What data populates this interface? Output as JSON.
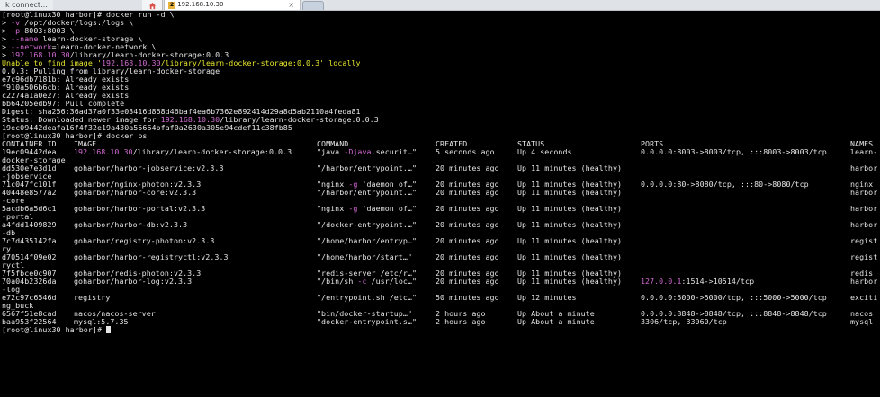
{
  "tabs": {
    "connect_label": "k connect...",
    "active_number": "2",
    "active_title": "192.168.10.30",
    "close_glyph": "×"
  },
  "icons": {
    "home": "home-icon",
    "new_tab": "new-tab-icon",
    "close": "close-icon"
  },
  "colors": {
    "background": "#000000",
    "text": "#e6e6e6",
    "ip": "#d46bd4",
    "warning": "#e6e62e"
  },
  "terminal": {
    "lines": [
      {
        "segs": [
          {
            "t": "[root@linux30 harbor]# docker run -d \\"
          }
        ]
      },
      {
        "segs": [
          {
            "t": "> "
          },
          {
            "t": "-v",
            "c": "mag"
          },
          {
            "t": " /opt/docker/logs:/logs \\"
          }
        ]
      },
      {
        "segs": [
          {
            "t": "> "
          },
          {
            "t": "-p",
            "c": "mag"
          },
          {
            "t": " 8003:8003 \\"
          }
        ]
      },
      {
        "segs": [
          {
            "t": "> "
          },
          {
            "t": "--name",
            "c": "mag"
          },
          {
            "t": " learn-docker-storage \\"
          }
        ]
      },
      {
        "segs": [
          {
            "t": "> "
          },
          {
            "t": "--network",
            "c": "mag"
          },
          {
            "t": "=learn-docker-network \\"
          }
        ]
      },
      {
        "segs": [
          {
            "t": "> "
          },
          {
            "t": "192.168.10.30",
            "c": "mag"
          },
          {
            "t": "/library/learn-docker-storage:0.0.3"
          }
        ]
      },
      {
        "segs": [
          {
            "t": "Unable to find image '",
            "c": "yel"
          },
          {
            "t": "192.168.10.30",
            "c": "mag"
          },
          {
            "t": "/library/learn-docker-storage:0.0.3' locally",
            "c": "yel"
          }
        ]
      },
      {
        "segs": [
          {
            "t": "0.0.3: Pulling from library/learn-docker-storage"
          }
        ]
      },
      {
        "segs": [
          {
            "t": "e7c96db7181b: Already exists"
          }
        ]
      },
      {
        "segs": [
          {
            "t": "f910a506b6cb: Already exists"
          }
        ]
      },
      {
        "segs": [
          {
            "t": "c2274a1a0e27: Already exists"
          }
        ]
      },
      {
        "segs": [
          {
            "t": "bb64205edb97: Pull complete"
          }
        ]
      },
      {
        "segs": [
          {
            "t": "Digest: sha256:36ad37a0f33e03416d868d46baf4ea6b7362e892414d29a8d5ab2110a4feda81"
          }
        ]
      },
      {
        "segs": [
          {
            "t": "Status: Downloaded newer image for "
          },
          {
            "t": "192.168.10.30",
            "c": "mag"
          },
          {
            "t": "/library/learn-docker-storage:0.0.3"
          }
        ]
      },
      {
        "segs": [
          {
            "t": "19ec09442deafa16f4f32e19a430a55664bfaf0a2630a305e94cdef11c38fb85"
          }
        ]
      },
      {
        "segs": [
          {
            "t": "[root@linux30 harbor]# docker ps"
          }
        ]
      }
    ],
    "ps_headers": [
      "CONTAINER ID",
      "IMAGE",
      "COMMAND",
      "CREATED",
      "STATUS",
      "PORTS",
      "NAMES"
    ],
    "ps_rows": [
      {
        "id": "19ec09442dea",
        "image": [
          {
            "t": "192.168.10.30",
            "c": "mag"
          },
          {
            "t": "/library/learn-docker-storage:0.0.3"
          }
        ],
        "command": [
          {
            "t": "\"java "
          },
          {
            "t": "-Djava",
            "c": "mag"
          },
          {
            "t": ".securit…\""
          }
        ],
        "created": "5 seconds ago",
        "status": "Up 4 seconds",
        "ports": [
          {
            "t": "0.0.0.0:8003->8003/tcp, :::8003->8003/tcp"
          }
        ],
        "names": "learn-"
      },
      {
        "cont": "docker-storage"
      },
      {
        "id": "dd530e7e3d1d",
        "image": [
          {
            "t": "goharbor/harbor-jobservice:v2.3.3"
          }
        ],
        "command": [
          {
            "t": "\"/harbor/entrypoint.…\""
          }
        ],
        "created": "20 minutes ago",
        "status": "Up 11 minutes (healthy)",
        "ports": [],
        "names": "harbor"
      },
      {
        "cont": "-jobservice"
      },
      {
        "id": "71c047fc101f",
        "image": [
          {
            "t": "goharbor/nginx-photon:v2.3.3"
          }
        ],
        "command": [
          {
            "t": "\"nginx "
          },
          {
            "t": "-g",
            "c": "mag"
          },
          {
            "t": " 'daemon of…\""
          }
        ],
        "created": "20 minutes ago",
        "status": "Up 11 minutes (healthy)",
        "ports": [
          {
            "t": "0.0.0.0:80->8080/tcp, :::80->8080/tcp"
          }
        ],
        "names": "nginx"
      },
      {
        "id": "40448e8577a2",
        "image": [
          {
            "t": "goharbor/harbor-core:v2.3.3"
          }
        ],
        "command": [
          {
            "t": "\"/harbor/entrypoint.…\""
          }
        ],
        "created": "20 minutes ago",
        "status": "Up 11 minutes (healthy)",
        "ports": [],
        "names": "harbor"
      },
      {
        "cont": "-core"
      },
      {
        "id": "5acdb6a5d6c1",
        "image": [
          {
            "t": "goharbor/harbor-portal:v2.3.3"
          }
        ],
        "command": [
          {
            "t": "\"nginx "
          },
          {
            "t": "-g",
            "c": "mag"
          },
          {
            "t": " 'daemon of…\""
          }
        ],
        "created": "20 minutes ago",
        "status": "Up 11 minutes (healthy)",
        "ports": [],
        "names": "harbor"
      },
      {
        "cont": "-portal"
      },
      {
        "id": "a4fdd1409829",
        "image": [
          {
            "t": "goharbor/harbor-db:v2.3.3"
          }
        ],
        "command": [
          {
            "t": "\"/docker-entrypoint.…\""
          }
        ],
        "created": "20 minutes ago",
        "status": "Up 11 minutes (healthy)",
        "ports": [],
        "names": "harbor"
      },
      {
        "cont": "-db"
      },
      {
        "id": "7c7d435142fa",
        "image": [
          {
            "t": "goharbor/registry-photon:v2.3.3"
          }
        ],
        "command": [
          {
            "t": "\"/home/harbor/entryp…\""
          }
        ],
        "created": "20 minutes ago",
        "status": "Up 11 minutes (healthy)",
        "ports": [],
        "names": "regist"
      },
      {
        "cont": "ry"
      },
      {
        "id": "d70514f09e02",
        "image": [
          {
            "t": "goharbor/harbor-registryctl:v2.3.3"
          }
        ],
        "command": [
          {
            "t": "\"/home/harbor/start…\""
          }
        ],
        "created": "20 minutes ago",
        "status": "Up 11 minutes (healthy)",
        "ports": [],
        "names": "regist"
      },
      {
        "cont": "ryctl"
      },
      {
        "id": "7f5fbce0c907",
        "image": [
          {
            "t": "goharbor/redis-photon:v2.3.3"
          }
        ],
        "command": [
          {
            "t": "\"redis-server /etc/r…\""
          }
        ],
        "created": "20 minutes ago",
        "status": "Up 11 minutes (healthy)",
        "ports": [],
        "names": "redis"
      },
      {
        "id": "70a04b2326da",
        "image": [
          {
            "t": "goharbor/harbor-log:v2.3.3"
          }
        ],
        "command": [
          {
            "t": "\"/bin/sh "
          },
          {
            "t": "-c",
            "c": "mag"
          },
          {
            "t": " /usr/loc…\""
          }
        ],
        "created": "20 minutes ago",
        "status": "Up 11 minutes (healthy)",
        "ports": [
          {
            "t": "127.0.0.1",
            "c": "mag"
          },
          {
            "t": ":1514->10514/tcp"
          }
        ],
        "names": "harbor"
      },
      {
        "cont": "-log"
      },
      {
        "id": "e72c97c6546d",
        "image": [
          {
            "t": "registry"
          }
        ],
        "command": [
          {
            "t": "\"/entrypoint.sh /etc…\""
          }
        ],
        "created": "50 minutes ago",
        "status": "Up 12 minutes",
        "ports": [
          {
            "t": "0.0.0.0:5000->5000/tcp, :::5000->5000/tcp"
          }
        ],
        "names": "exciti"
      },
      {
        "cont": "ng_buck"
      },
      {
        "id": "6567f51e8cad",
        "image": [
          {
            "t": "nacos/nacos-server"
          }
        ],
        "command": [
          {
            "t": "\"bin/docker-startup…\""
          }
        ],
        "created": "2 hours ago",
        "status": "Up About a minute",
        "ports": [
          {
            "t": "0.0.0.0:8848->8848/tcp, :::8848->8848/tcp"
          }
        ],
        "names": "nacos"
      },
      {
        "id": "baa953f22564",
        "image": [
          {
            "t": "mysql:5.7.35"
          }
        ],
        "command": [
          {
            "t": "\"docker-entrypoint.s…\""
          }
        ],
        "created": "2 hours ago",
        "status": "Up About a minute",
        "ports": [
          {
            "t": "3306/tcp, 33060/tcp"
          }
        ],
        "names": "mysql"
      }
    ],
    "prompt": "[root@linux30 harbor]# "
  }
}
